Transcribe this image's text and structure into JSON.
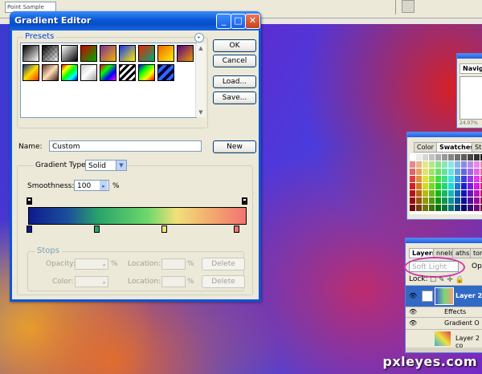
{
  "topbar": {
    "sample_value": "Point Sample"
  },
  "dialog": {
    "title": "Gradient Editor",
    "presets_legend": "Presets",
    "buttons": {
      "ok": "OK",
      "cancel": "Cancel",
      "load": "Load...",
      "save": "Save...",
      "new": "New"
    },
    "name_label": "Name:",
    "name_value": "Custom",
    "gradient_type_label": "Gradient Type:",
    "gradient_type_value": "Solid",
    "smoothness_label": "Smoothness:",
    "smoothness_value": "100",
    "smoothness_unit": "%",
    "stops": {
      "legend": "Stops",
      "opacity_label": "Opacity:",
      "color_label": "Color:",
      "location_label": "Location:",
      "percent": "%",
      "delete_label": "Delete"
    }
  },
  "panels": {
    "navigator": {
      "tab": "Navig",
      "zoom": "24.07%"
    },
    "swatches": {
      "tabs": [
        "Color",
        "Swatches",
        "St"
      ]
    },
    "layers": {
      "tabs": [
        "Layers",
        "nnels",
        "aths",
        "tor"
      ],
      "blend_mode": "Soft Light",
      "opacity_label": "Opa",
      "lock_label": "Lock:",
      "rows": [
        {
          "name": "Layer 2"
        },
        {
          "name": "Effects"
        },
        {
          "name": "Gradient O"
        },
        {
          "name": "Layer 2 co"
        }
      ]
    }
  },
  "watermark": "pxleyes.com",
  "colors": {
    "accent": "#0a56d8",
    "highlight_ellipse": "#d63aa8"
  }
}
